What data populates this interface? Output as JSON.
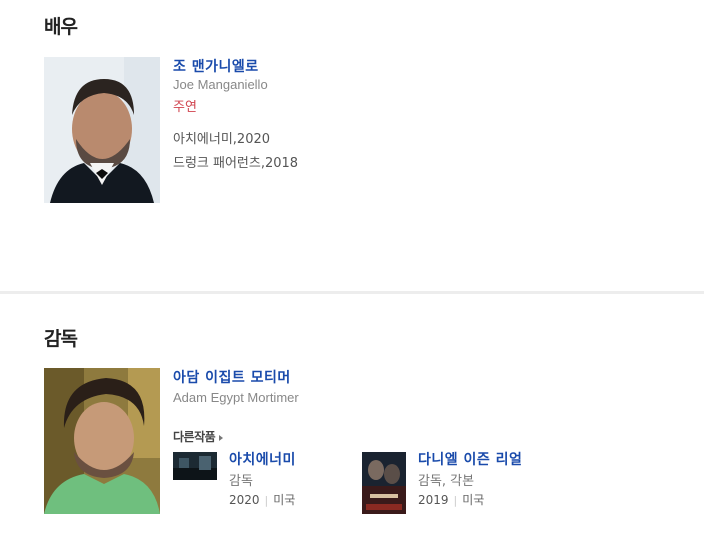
{
  "actor_section": {
    "title": "배우",
    "person": {
      "name_ko": "조 맨가니엘로",
      "name_en": "Joe Manganiello",
      "role": "주연",
      "films": [
        "아치에너미,2020",
        "드렁크 패어런츠,2018"
      ]
    }
  },
  "director_section": {
    "title": "감독",
    "person": {
      "name_ko": "아담 이집트 모티머",
      "name_en": "Adam Egypt Mortimer"
    },
    "other_works_label": "다른작품",
    "works": [
      {
        "title": "아치에너미",
        "role": "감독",
        "year": "2020",
        "country": "미국"
      },
      {
        "title": "다니엘 이즌 리얼",
        "role": "감독, 각본",
        "year": "2019",
        "country": "미국"
      }
    ]
  }
}
